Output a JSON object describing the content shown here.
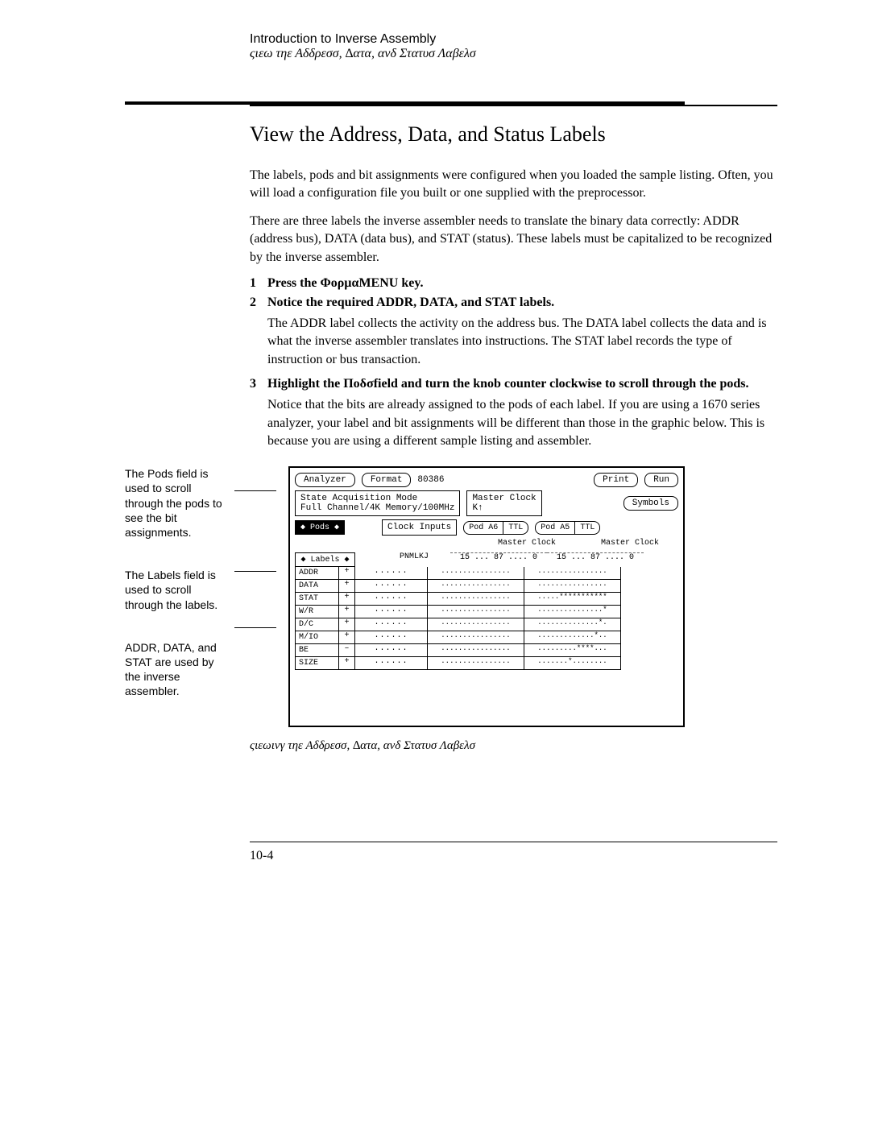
{
  "header": {
    "line1": "Introduction to Inverse Assembly",
    "line2": "ςιεω τηε Αδδρεσσ, ∆ατα, ανδ Στατυσ Λαβελσ"
  },
  "title": "View the Address, Data, and Status Labels",
  "intro1": "The labels, pods and bit assignments were configured when you loaded the sample listing.  Often, you will load a configuration file you built or one supplied with the preprocessor.",
  "intro2": "There are three labels the inverse assembler needs to translate the binary data correctly:  ADDR (address bus), DATA (data bus), and STAT (status). These labels must be capitalized to be recognized by the inverse assembler.",
  "steps": [
    {
      "num": "1",
      "text": "Press the ΦορµαΜENU key."
    },
    {
      "num": "2",
      "text": "Notice the required ADDR, DATA, and STAT labels.",
      "body": "The ADDR label collects the activity on the address bus.  The DATA label collects the data and is what the inverse assembler translates into instructions.  The STAT label records the type of instruction or bus transaction."
    },
    {
      "num": "3",
      "text": "Highlight the Ποδσfield and turn the knob counter clockwise to scroll through the pods.",
      "body": "Notice that the bits are already assigned to the pods of each label.  If you are using a 1670 series analyzer, your label and bit assignments will be different than those in the graphic below.  This is because you are using a different sample listing and assembler."
    }
  ],
  "annotations": {
    "a1": "The Pods field is used to scroll through the pods to see the bit assignments.",
    "a2": "The Labels field is used to scroll through the labels.",
    "a3": "ADDR, DATA, and STAT are used by the inverse assembler."
  },
  "screenshot": {
    "topButtons": {
      "analyzer": "Analyzer",
      "format": "Format",
      "chip": "80386",
      "print": "Print",
      "run": "Run"
    },
    "acqBox": {
      "l1": "State Acquisition Mode",
      "l2": "Full Channel/4K Memory/100MHz"
    },
    "masterClock": "Master Clock",
    "masterK": "K↑",
    "symbols": "Symbols",
    "podsField": "◆  Pods  ◆",
    "clockInputs": "Clock Inputs",
    "podA6": "Pod A6",
    "podA5": "Pod A5",
    "ttl": "TTL",
    "labelsHeader": "◆ Labels ◆",
    "colPNMLKJ": "PNMLKJ",
    "bitsHeader": "15 ... 87 .... 0",
    "rows": [
      {
        "label": "ADDR",
        "sign": "+",
        "v": "......",
        "b1": "................",
        "b2": "................"
      },
      {
        "label": "DATA",
        "sign": "+",
        "v": "......",
        "b1": "................",
        "b2": "................"
      },
      {
        "label": "STAT",
        "sign": "+",
        "v": "......",
        "b1": "................",
        "b2": ".....***********"
      },
      {
        "label": "W/R",
        "sign": "+",
        "v": "......",
        "b1": "................",
        "b2": "...............*"
      },
      {
        "label": "D/C",
        "sign": "+",
        "v": "......",
        "b1": "................",
        "b2": "..............*."
      },
      {
        "label": "M/IO",
        "sign": "+",
        "v": "......",
        "b1": "................",
        "b2": ".............*.."
      },
      {
        "label": "BE",
        "sign": "–",
        "v": "......",
        "b1": "................",
        "b2": ".........****..."
      },
      {
        "label": "SIZE",
        "sign": "+",
        "v": "......",
        "b1": "................",
        "b2": ".......*........"
      }
    ],
    "caption": "ςιεωινγ τηε Αδδρεσσ, ∆ατα, ανδ Στατυσ Λαβελσ"
  },
  "pageNumber": "10-4"
}
